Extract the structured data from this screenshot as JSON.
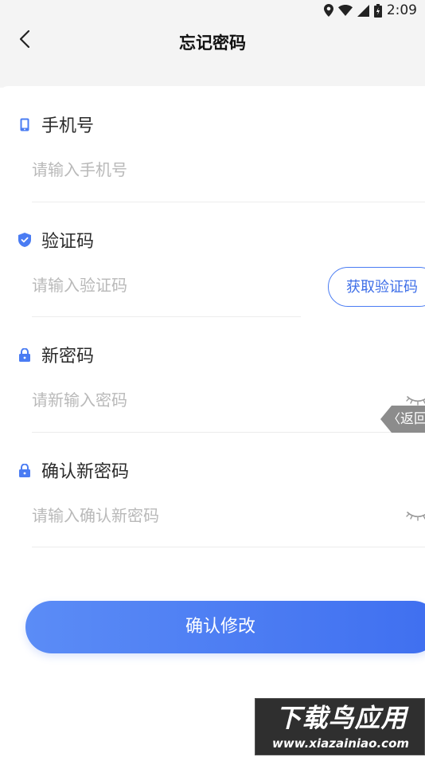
{
  "status_bar": {
    "time": "2:09",
    "icons": [
      "location-icon",
      "wifi-icon",
      "signal-icon",
      "battery-icon"
    ]
  },
  "header": {
    "back_icon": "chevron-left-icon",
    "title": "忘记密码"
  },
  "form": {
    "phone": {
      "label": "手机号",
      "icon": "phone-icon",
      "placeholder": "请输入手机号",
      "value": ""
    },
    "code": {
      "label": "验证码",
      "icon": "shield-check-icon",
      "placeholder": "请输入验证码",
      "value": "",
      "get_code_label": "获取验证码"
    },
    "new_password": {
      "label": "新密码",
      "icon": "lock-icon",
      "placeholder": "请新输入密码",
      "value": "",
      "visibility_icon": "eye-closed-icon"
    },
    "confirm_password": {
      "label": "确认新密码",
      "icon": "lock-icon",
      "placeholder": "请输入确认新密码",
      "value": "",
      "visibility_icon": "eye-closed-icon"
    }
  },
  "floating_return": {
    "label": "返回"
  },
  "submit": {
    "label": "确认修改"
  },
  "watermark": {
    "title": "下载鸟应用",
    "url": "www.xiazainiao.com"
  },
  "colors": {
    "accent": "#3f6ff0",
    "accent_light": "#5b8cf6",
    "placeholder": "#b9b9b9",
    "header_bg": "#f4f4f4"
  }
}
